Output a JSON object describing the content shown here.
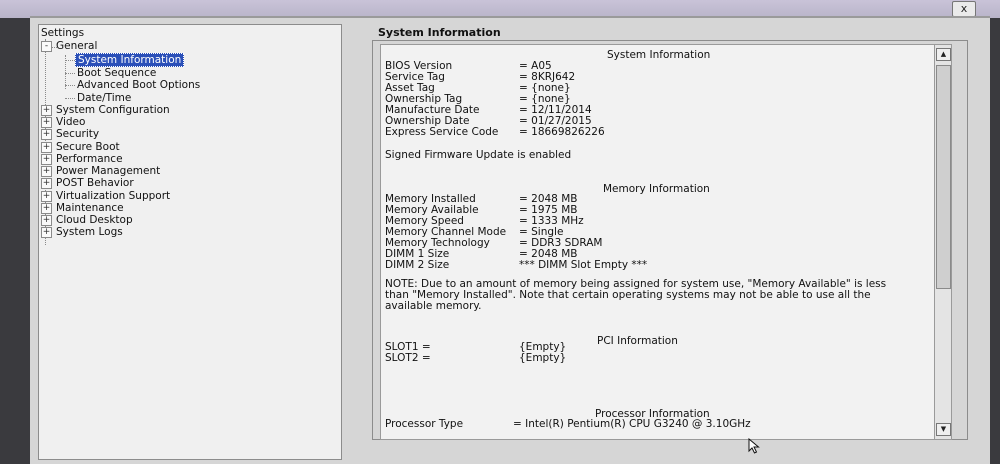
{
  "window": {
    "close_label": "x"
  },
  "tree": {
    "root": "Settings",
    "general": "General",
    "general_children": [
      "System Information",
      "Boot Sequence",
      "Advanced Boot Options",
      "Date/Time"
    ],
    "sections": [
      "System Configuration",
      "Video",
      "Security",
      "Secure Boot",
      "Performance",
      "Power Management",
      "POST Behavior",
      "Virtualization Support",
      "Maintenance",
      "Cloud Desktop",
      "System Logs"
    ],
    "expand_symbol": "+",
    "collapse_symbol": "-"
  },
  "panel": {
    "header": "System Information",
    "system_title": "System Information",
    "system_rows": [
      {
        "k": "BIOS Version",
        "v": "= A05"
      },
      {
        "k": "Service Tag",
        "v": "= 8KRJ642"
      },
      {
        "k": "Asset Tag",
        "v": "= {none}"
      },
      {
        "k": "Ownership Tag",
        "v": "= {none}"
      },
      {
        "k": "Manufacture Date",
        "v": "= 12/11/2014"
      },
      {
        "k": "Ownership Date",
        "v": "= 01/27/2015"
      },
      {
        "k": "Express Service Code",
        "v": "= 18669826226"
      }
    ],
    "signed_firmware": "Signed Firmware Update is enabled",
    "memory_title": "Memory Information",
    "memory_rows": [
      {
        "k": "Memory Installed",
        "v": "= 2048 MB"
      },
      {
        "k": "Memory Available",
        "v": "= 1975 MB"
      },
      {
        "k": "Memory Speed",
        "v": "= 1333 MHz"
      },
      {
        "k": "Memory Channel Mode",
        "v": "= Single"
      },
      {
        "k": "Memory Technology",
        "v": "= DDR3 SDRAM"
      },
      {
        "k": "DIMM 1 Size",
        "v": "= 2048 MB"
      },
      {
        "k": "DIMM 2 Size",
        "v": "*** DIMM Slot Empty ***"
      }
    ],
    "note": "NOTE: Due to an amount of memory being assigned for system use, \"Memory Available\" is less than \"Memory Installed\". Note that certain operating systems may not be able to use all the available memory.",
    "pci_title": "PCI Information",
    "pci_rows": [
      {
        "k": "SLOT1 =",
        "v": "{Empty}"
      },
      {
        "k": "SLOT2 =",
        "v": "{Empty}"
      }
    ],
    "processor_title": "Processor Information",
    "processor_rows": [
      {
        "k": "Processor Type",
        "v": "= Intel(R) Pentium(R) CPU G3240 @ 3.10GHz"
      }
    ]
  },
  "icons": {
    "scroll_up": "scroll-up-arrow-icon",
    "scroll_down": "scroll-down-arrow-icon",
    "cursor": "mouse-cursor-icon"
  }
}
